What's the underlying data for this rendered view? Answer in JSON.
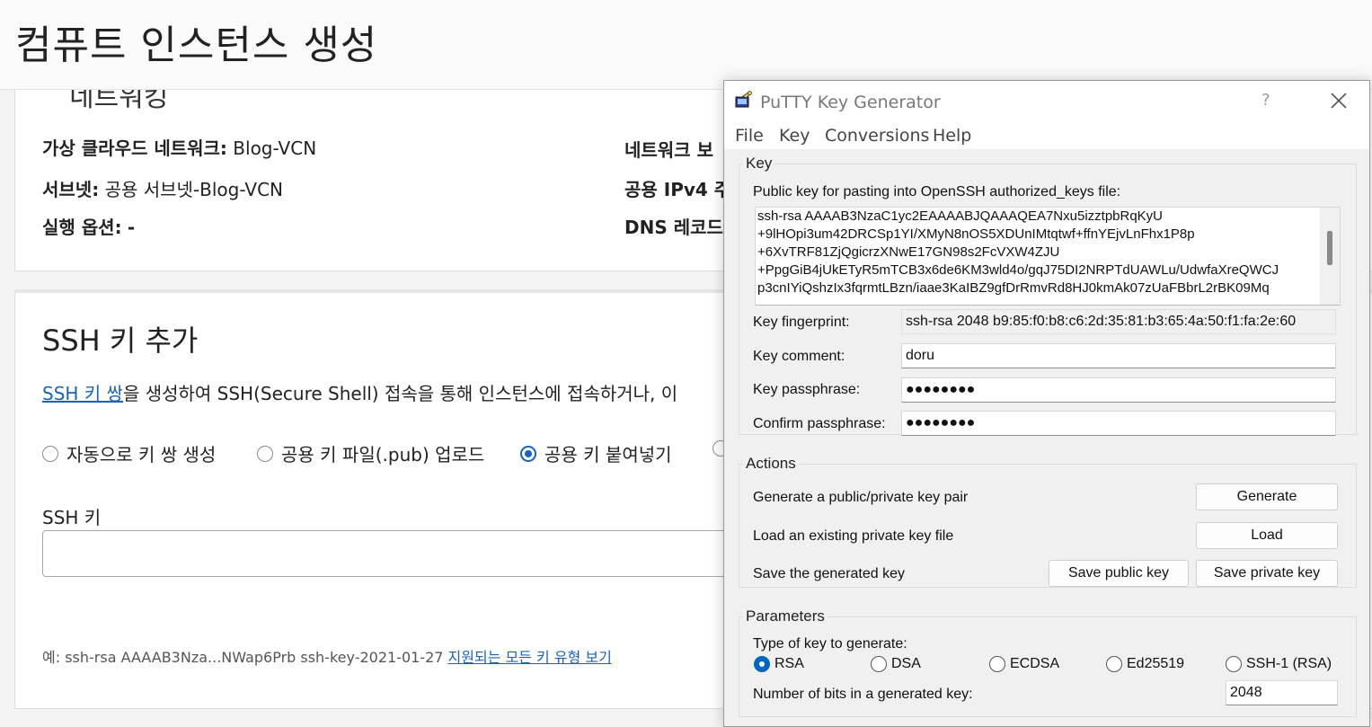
{
  "console": {
    "page_title": "컴퓨트 인스턴스 생성",
    "networking": {
      "section_title": "네트워킹",
      "vcn_label": "가상 클라우드 네트워크:",
      "vcn_value": "Blog-VCN",
      "subnet_label": "서브넷:",
      "subnet_value": "공용 서브넷-Blog-VCN",
      "launch_label": "실행 옵션:",
      "launch_value": "-",
      "right_col_1": "네트워크 보",
      "right_col_2": "공용 IPv4 주",
      "right_col_3": "DNS 레코드"
    },
    "ssh": {
      "title": "SSH 키 추가",
      "desc_link": "SSH 키 쌍",
      "desc_text": "을 생성하여 SSH(Secure Shell) 접속을 통해 인스턴스에 접속하거나, 이",
      "options": [
        "자동으로 키 쌍 생성",
        "공용 키 파일(.pub) 업로드",
        "공용 키 붙여넣기"
      ],
      "selected_option": "공용 키 붙여넣기",
      "key_label": "SSH 키",
      "example_text": "예: ssh-rsa AAAAB3Nza...NWap6Prb ssh-key-2021-01-27 ",
      "example_link": "지원되는 모든 키 유형 보기"
    }
  },
  "putty": {
    "window_title": "PuTTY Key Generator",
    "help_glyph": "?",
    "menu": [
      "File",
      "Key",
      "Conversions",
      "Help"
    ],
    "key_group": {
      "legend": "Key",
      "public_key_label": "Public key for pasting into OpenSSH authorized_keys file:",
      "public_key_lines": [
        "ssh-rsa AAAAB3NzaC1yc2EAAAABJQAAAQEA7Nxu5izztpbRqKyU",
        "+9lHOpi3um42DRCSp1YI/XMyN8nOS5XDUnIMtqtwf+ffnYEjvLnFhx1P8p",
        "+6XvTRF81ZjQgicrzXNwE17GN98s2FcVXW4ZJU",
        "+PpgGiB4jUkETyR5mTCB3x6de6KM3wld4o/gqJ75DI2NRPTdUAWLu/UdwfaXreQWCJ",
        "p3cnIYiQshzIx3fqrmtLBzn/iaae3KaIBZ9gfDrRmvRd8HJ0kmAk07zUaFBbrL2rBK09Mq"
      ],
      "fingerprint_label": "Key fingerprint:",
      "fingerprint_value": "ssh-rsa 2048 b9:85:f0:b8:c6:2d:35:81:b3:65:4a:50:f1:fa:2e:60",
      "comment_label": "Key comment:",
      "comment_value": "doru",
      "passphrase_label": "Key passphrase:",
      "passphrase_value": "●●●●●●●●",
      "confirm_label": "Confirm passphrase:",
      "confirm_value": "●●●●●●●●"
    },
    "actions": {
      "legend": "Actions",
      "generate_label": "Generate a public/private key pair",
      "generate_button": "Generate",
      "load_label": "Load an existing private key file",
      "load_button": "Load",
      "save_label": "Save the generated key",
      "save_public_button": "Save public key",
      "save_private_button": "Save private key"
    },
    "parameters": {
      "legend": "Parameters",
      "type_label": "Type of key to generate:",
      "key_types": [
        "RSA",
        "DSA",
        "ECDSA",
        "Ed25519",
        "SSH-1 (RSA)"
      ],
      "selected_type": "RSA",
      "bits_label": "Number of bits in a generated key:",
      "bits_value": "2048"
    }
  }
}
